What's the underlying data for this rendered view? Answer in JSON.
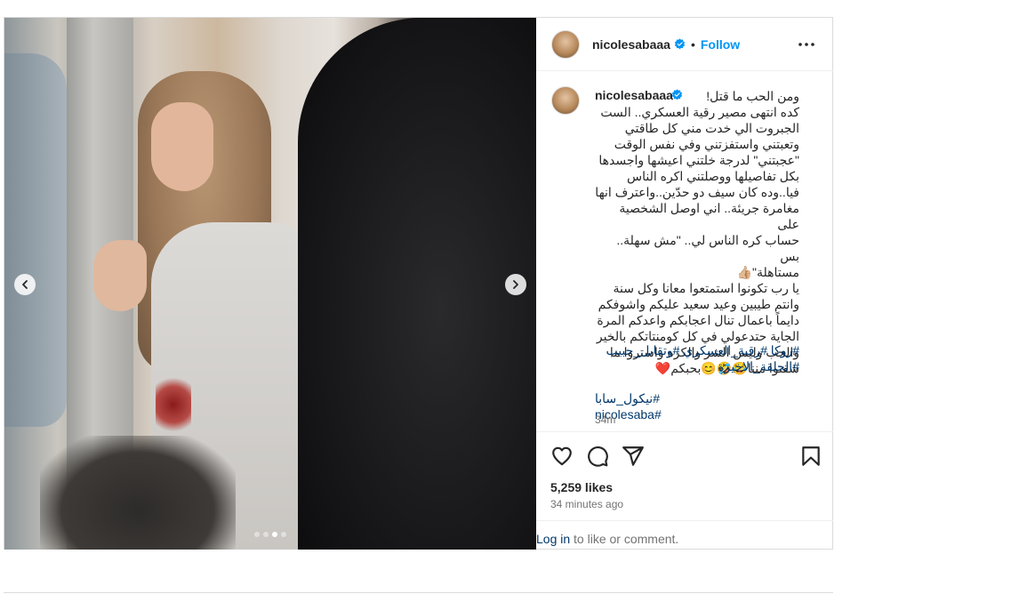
{
  "post": {
    "username": "nicolesabaaa",
    "follow_label": "Follow",
    "separator": "•",
    "caption": "ومن الحب ما قتل!\nكده انتهى مصير رقية العسكري.. الست\nالجبروت الي خدت مني كل طاقتي\nوتعبتني واستفزتني وفي نفس الوقت\n\"عجبتني\" لدرجة خلتني اعيشها واجسدها\nبكل تفاصيلها ووصلتني اكره الناس\nفيا..وده كان سيف دو حدّين..واعترف انها\nمغامرة جريئة.. اني اوصل الشخصية على\nحساب كره الناس لي.. \"مش سهلة.. بس\nمستاهلة\"👍🏼\nيا رب تكونوا استمتعوا معانا وكل سنة\nوانتم طيبين وعيد سعيد عليكم واشوفكم\nدايماً باعمال تنال اعجابكم واعدكم المرة\nالجاية حتدعولي في كل كومنتاتكم بالخير\nوالحب وليس الشر والكره واستروا ما\nشفتوا مننا😂🤣😊بحبكم❤️",
    "hashtags": "#روكا #رقية_العسكري #وتقابل_حبيب\n#الحلقة_الاخيرة",
    "hashtags2": "#نيكول_سابا #nicolesaba",
    "caption_time": "34m",
    "likes": "5,259 likes",
    "time_ago": "34 minutes ago",
    "login_link": "Log in",
    "login_rest": " to like or comment."
  },
  "carousel": {
    "total": 4,
    "active_index": 2
  },
  "colors": {
    "accent": "#0095f6",
    "link": "#00376b",
    "verified": "#0095f6",
    "muted": "#737373"
  },
  "icons": [
    "verified-badge-icon",
    "more-options-icon",
    "heart-icon",
    "comment-icon",
    "share-icon",
    "bookmark-icon",
    "chevron-left-icon",
    "chevron-right-icon"
  ]
}
